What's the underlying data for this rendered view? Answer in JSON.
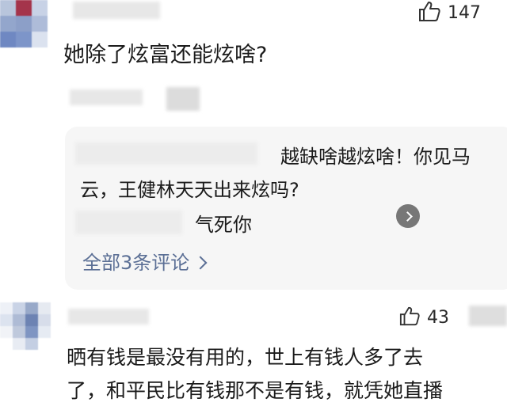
{
  "comments": [
    {
      "text": "她除了炫富还能炫啥?",
      "likes": "147"
    },
    {
      "text_lines": [
        "晒有钱是最没有用的，世上有钱人多了去",
        "了，和平民比有钱那不是有钱，就凭她直播"
      ],
      "likes": "43"
    }
  ],
  "replies": {
    "items": [
      {
        "text_line1": "越缺啥越炫啥！你见马",
        "text_line2": "云，王健林天天出来炫吗?"
      },
      {
        "text": "气死你"
      }
    ],
    "more_label": "全部3条评论"
  },
  "icons": {
    "like": "thumbs-up-icon",
    "arrow": "chevron-right-icon"
  },
  "colors": {
    "background": "#ffffff",
    "reply_box": "#f6f6f6",
    "link": "#5b6f95",
    "text": "#1b1b1b"
  }
}
